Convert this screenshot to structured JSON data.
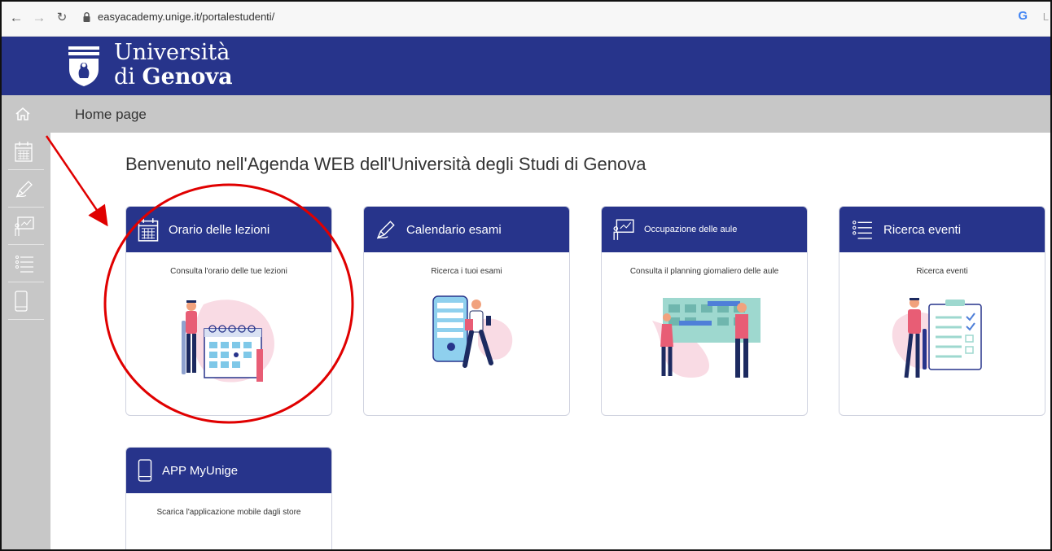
{
  "browser": {
    "url": "easyacademy.unige.it/portalestudenti/",
    "extra": "L"
  },
  "header": {
    "logo_line1": "Università",
    "logo_line2_prefix": "di ",
    "logo_line2_bold": "Genova"
  },
  "sidebar": {
    "items": [
      {
        "icon": "home-icon"
      },
      {
        "icon": "calendar-icon"
      },
      {
        "icon": "pen-icon"
      },
      {
        "icon": "classroom-icon"
      },
      {
        "icon": "list-icon"
      },
      {
        "icon": "phone-icon"
      }
    ]
  },
  "breadcrumb": "Home page",
  "welcome": "Benvenuto nell'Agenda WEB dell'Università degli Studi di Genova",
  "cards": [
    {
      "title": "Orario delle lezioni",
      "desc": "Consulta l'orario delle tue lezioni",
      "icon": "calendar-icon"
    },
    {
      "title": "Calendario esami",
      "desc": "Ricerca i tuoi esami",
      "icon": "pen-icon"
    },
    {
      "title": "Occupazione delle aule",
      "desc": "Consulta il planning giornaliero delle aule",
      "icon": "classroom-icon"
    },
    {
      "title": "Ricerca eventi",
      "desc": "Ricerca eventi",
      "icon": "list-icon"
    },
    {
      "title": "APP MyUnige",
      "desc": "Scarica l'applicazione mobile dagli store",
      "icon": "phone-icon"
    }
  ],
  "colors": {
    "brand": "#27348b",
    "annotation": "#e00000"
  }
}
